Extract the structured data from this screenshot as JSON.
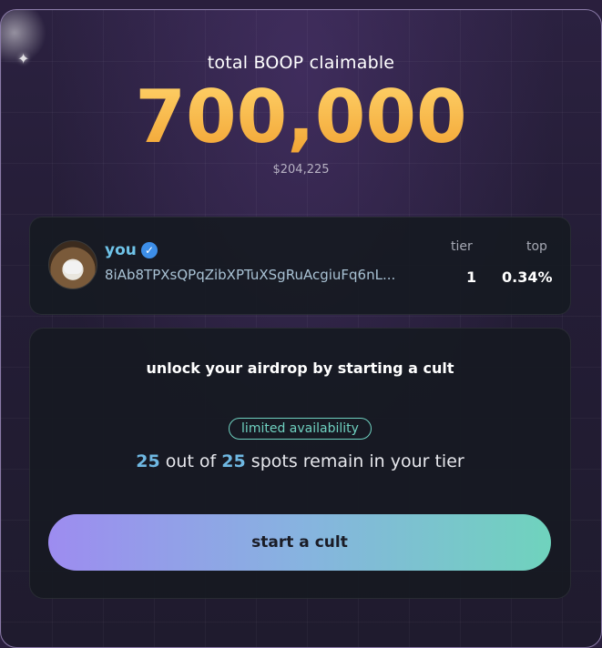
{
  "hero": {
    "label": "total BOOP claimable",
    "amount": "700,000",
    "usd_value": "$204,225"
  },
  "user": {
    "name": "you",
    "verified": true,
    "wallet": "8iAb8TPXsQPqZibXPTuXSgRuAcgiuFq6nL...",
    "tier_label": "tier",
    "tier_value": "1",
    "top_label": "top",
    "top_value": "0.34%"
  },
  "cult": {
    "title": "unlock your airdrop by starting a cult",
    "badge": "limited availability",
    "spots_remaining": "25",
    "spots_middle": " out of ",
    "spots_total": "25",
    "spots_suffix": " spots remain in your tier",
    "cta_label": "start a cult"
  },
  "colors": {
    "amount_gold": "#f3a63b",
    "accent_blue": "#6fb8e2",
    "badge_teal": "#6fd1c0",
    "cta_gradient_start": "#9d8cf0",
    "cta_gradient_end": "#6fd3bd"
  }
}
